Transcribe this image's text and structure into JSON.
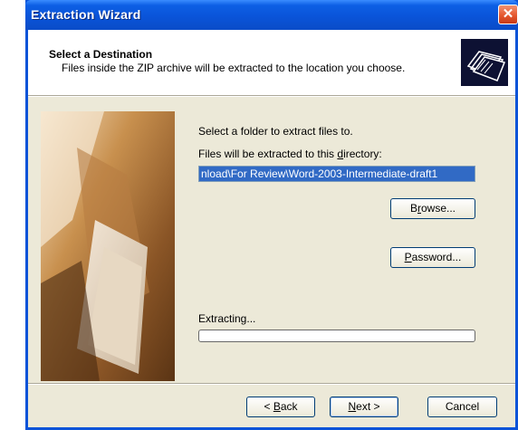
{
  "window": {
    "title": "Extraction Wizard",
    "close_glyph": "✕"
  },
  "header": {
    "title": "Select a Destination",
    "description": "Files inside the ZIP archive will be extracted to the location you choose.",
    "icon": "folder-documents-icon"
  },
  "main": {
    "instruction": "Select a folder to extract files to.",
    "dir_label_prefix": "Files will be extracted to this ",
    "dir_label_accel": "d",
    "dir_label_suffix": "irectory:",
    "directory_value": "nload\\For Review\\Word-2003-Intermediate-draft1",
    "browse_accel": "r",
    "browse_pre": "B",
    "browse_post": "owse...",
    "password_accel": "P",
    "password_post": "assword...",
    "extracting_label": "Extracting...",
    "progress_value": 0
  },
  "footer": {
    "back_pre": "< ",
    "back_accel": "B",
    "back_post": "ack",
    "next_accel": "N",
    "next_post": "ext >",
    "cancel_label": "Cancel"
  },
  "colors": {
    "titlebar": "#0a54d9",
    "selection": "#316ac5",
    "dialog_bg": "#ece9d8"
  }
}
